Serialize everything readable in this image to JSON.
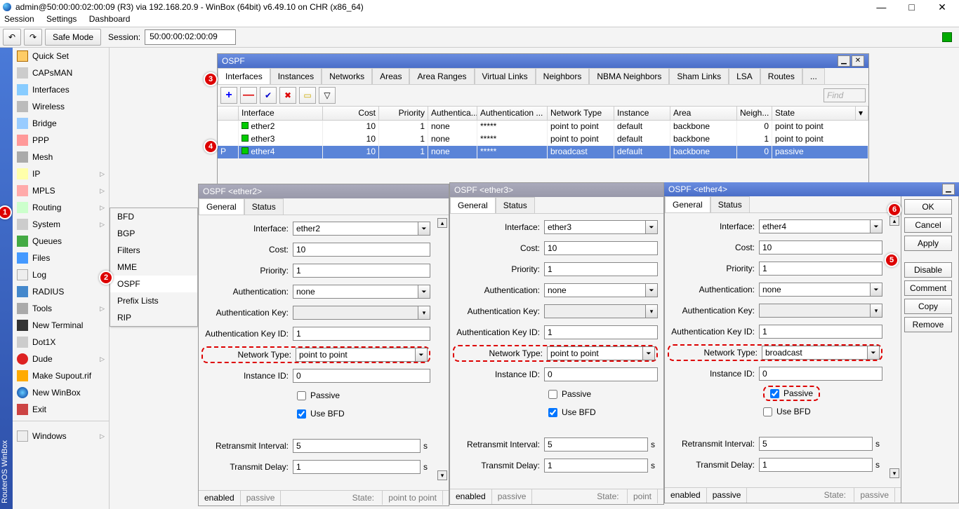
{
  "window": {
    "title": "admin@50:00:00:02:00:09 (R3) via 192.168.20.9 - WinBox (64bit) v6.49.10 on CHR (x86_64)"
  },
  "menubar": {
    "session": "Session",
    "settings": "Settings",
    "dashboard": "Dashboard"
  },
  "toolbar": {
    "safe_mode": "Safe Mode",
    "session_label": "Session:",
    "session_value": "50:00:00:02:00:09"
  },
  "sidebar": {
    "title_rot": "RouterOS WinBox",
    "items": [
      {
        "label": "Quick Set"
      },
      {
        "label": "CAPsMAN"
      },
      {
        "label": "Interfaces"
      },
      {
        "label": "Wireless"
      },
      {
        "label": "Bridge"
      },
      {
        "label": "PPP"
      },
      {
        "label": "Mesh"
      },
      {
        "label": "IP",
        "arrow": true
      },
      {
        "label": "MPLS",
        "arrow": true
      },
      {
        "label": "Routing",
        "arrow": true
      },
      {
        "label": "System",
        "arrow": true
      },
      {
        "label": "Queues"
      },
      {
        "label": "Files"
      },
      {
        "label": "Log"
      },
      {
        "label": "RADIUS"
      },
      {
        "label": "Tools",
        "arrow": true
      },
      {
        "label": "New Terminal"
      },
      {
        "label": "Dot1X"
      },
      {
        "label": "Dude",
        "arrow": true
      },
      {
        "label": "Make Supout.rif"
      },
      {
        "label": "New WinBox"
      },
      {
        "label": "Exit"
      },
      {
        "label": "Windows",
        "arrow": true
      }
    ]
  },
  "submenu": {
    "items": [
      {
        "label": "BFD"
      },
      {
        "label": "BGP"
      },
      {
        "label": "Filters"
      },
      {
        "label": "MME"
      },
      {
        "label": "OSPF"
      },
      {
        "label": "Prefix Lists"
      },
      {
        "label": "RIP"
      }
    ]
  },
  "ospf": {
    "title": "OSPF",
    "tabs": [
      "Interfaces",
      "Instances",
      "Networks",
      "Areas",
      "Area Ranges",
      "Virtual Links",
      "Neighbors",
      "NBMA Neighbors",
      "Sham Links",
      "LSA",
      "Routes",
      "..."
    ],
    "find": "Find",
    "cols": [
      "Interface",
      "Cost",
      "Priority",
      "Authentica...",
      "Authentication ...",
      "Network Type",
      "Instance",
      "Area",
      "Neigh...",
      "State"
    ],
    "rows": [
      {
        "flag": "",
        "iface": "ether2",
        "cost": "10",
        "prio": "1",
        "auth": "none",
        "akey": "*****",
        "ntype": "point to point",
        "inst": "default",
        "area": "backbone",
        "neigh": "0",
        "state": "point to point"
      },
      {
        "flag": "",
        "iface": "ether3",
        "cost": "10",
        "prio": "1",
        "auth": "none",
        "akey": "*****",
        "ntype": "point to point",
        "inst": "default",
        "area": "backbone",
        "neigh": "1",
        "state": "point to point"
      },
      {
        "flag": "P",
        "iface": "ether4",
        "cost": "10",
        "prio": "1",
        "auth": "none",
        "akey": "*****",
        "ntype": "broadcast",
        "inst": "default",
        "area": "backbone",
        "neigh": "0",
        "state": "passive"
      }
    ]
  },
  "ifacewin": {
    "tabs": [
      "General",
      "Status"
    ],
    "labels": {
      "interface": "Interface:",
      "cost": "Cost:",
      "priority": "Priority:",
      "auth": "Authentication:",
      "authkey": "Authentication Key:",
      "authkeyid": "Authentication Key ID:",
      "ntype": "Network Type:",
      "instid": "Instance ID:",
      "passive": "Passive",
      "usebfd": "Use BFD",
      "retransmit": "Retransmit Interval:",
      "transmit": "Transmit Delay:",
      "seconds": "s"
    },
    "status": {
      "enabled": "enabled",
      "passive": "passive",
      "stateprefix": "State: "
    }
  },
  "e2": {
    "title": "OSPF <ether2>",
    "interface": "ether2",
    "cost": "10",
    "priority": "1",
    "auth": "none",
    "authkey": "",
    "authkeyid": "1",
    "ntype": "point to point",
    "instid": "0",
    "passive": false,
    "usebfd": true,
    "retransmit": "5",
    "transmit": "1",
    "state": "point to point"
  },
  "e3": {
    "title": "OSPF <ether3>",
    "interface": "ether3",
    "cost": "10",
    "priority": "1",
    "auth": "none",
    "authkey": "",
    "authkeyid": "1",
    "ntype": "point to point",
    "instid": "0",
    "passive": false,
    "usebfd": true,
    "retransmit": "5",
    "transmit": "1",
    "state": "point"
  },
  "e4": {
    "title": "OSPF <ether4>",
    "interface": "ether4",
    "cost": "10",
    "priority": "1",
    "auth": "none",
    "authkey": "",
    "authkeyid": "1",
    "ntype": "broadcast",
    "instid": "0",
    "passive": true,
    "usebfd": false,
    "retransmit": "5",
    "transmit": "1",
    "state": "passive"
  },
  "buttons": {
    "ok": "OK",
    "cancel": "Cancel",
    "apply": "Apply",
    "disable": "Disable",
    "comment": "Comment",
    "copy": "Copy",
    "remove": "Remove"
  },
  "callouts": {
    "c1": "1",
    "c2": "2",
    "c3": "3",
    "c4": "4",
    "c5": "5",
    "c6": "6"
  }
}
